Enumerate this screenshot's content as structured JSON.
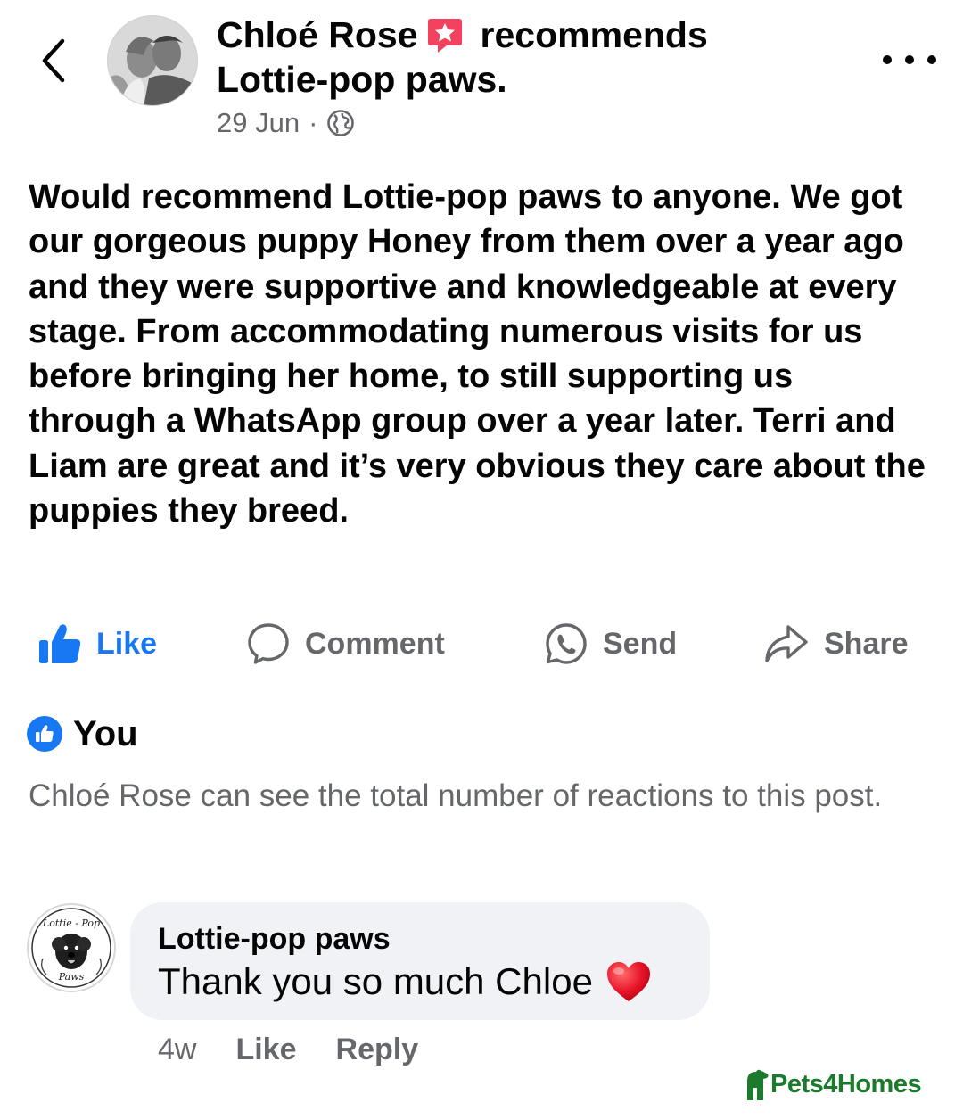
{
  "header": {
    "author": "Chloé Rose",
    "verb": "recommends",
    "page": "Lottie-pop paws.",
    "date": "29 Jun",
    "separator": "·",
    "audience_icon": "globe-icon"
  },
  "post": {
    "text": "Would recommend Lottie-pop paws to anyone. We got our gorgeous puppy Honey from them over a year ago and they were supportive and knowledgeable at every stage. From accommodating numerous visits for us before bringing her home, to still supporting us through a WhatsApp group over a year later. Terri and Liam are great and it’s very obvious they care about the puppies they breed."
  },
  "actions": {
    "like": "Like",
    "comment": "Comment",
    "send": "Send",
    "share": "Share"
  },
  "reactions": {
    "summary": "You",
    "notice": "Chloé Rose can see the total number of reactions to this post."
  },
  "comment": {
    "author": "Lottie-pop paws",
    "text": "Thank you so much Chloe",
    "emoji": "heart-icon",
    "time": "4w",
    "like": "Like",
    "reply": "Reply"
  },
  "watermark": {
    "text": "Pets4Homes"
  },
  "colors": {
    "accent": "#1877f2",
    "secondary_text": "#65676b",
    "bubble": "#f0f2f5",
    "recommend_badge": "#f3425f",
    "watermark": "#1b7a2c"
  }
}
